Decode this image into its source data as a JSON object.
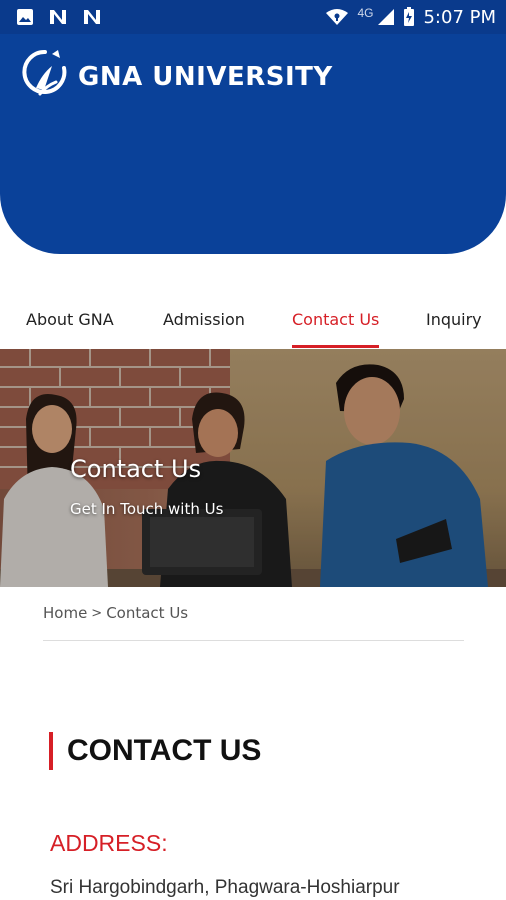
{
  "status_bar": {
    "network": "4G",
    "time": "5:07 PM",
    "icons": [
      "image-icon",
      "n-notification-icon",
      "n-notification-icon",
      "wifi-icon",
      "signal-icon",
      "battery-icon"
    ]
  },
  "header": {
    "logo_text": "GNA UNIVERSITY",
    "background_color": "#0a4199"
  },
  "tabs": [
    {
      "label": "About GNA",
      "active": false
    },
    {
      "label": "Admission",
      "active": false
    },
    {
      "label": "Contact Us",
      "active": true
    },
    {
      "label": "Inquiry",
      "active": false
    }
  ],
  "banner": {
    "title": "Contact Us",
    "subtitle": "Get In Touch with Us"
  },
  "breadcrumb": {
    "home": "Home",
    "separator": ">",
    "current": "Contact Us"
  },
  "contact": {
    "heading": "CONTACT US",
    "address_label": "ADDRESS:",
    "address_line": "Sri Hargobindgarh, Phagwara-Hoshiarpur"
  },
  "colors": {
    "accent": "#d61f26",
    "brand_blue": "#0a4199",
    "status_bar": "#0a3a8c"
  }
}
